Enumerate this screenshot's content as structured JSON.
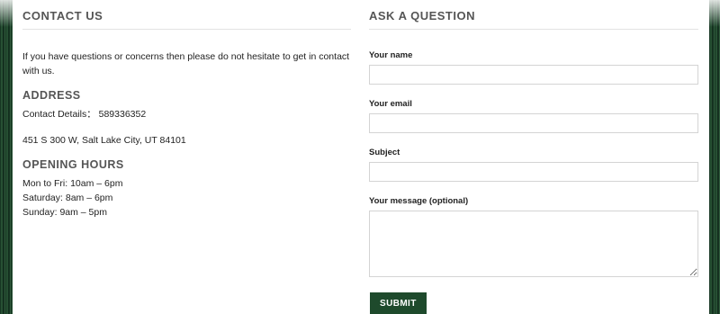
{
  "contact": {
    "title": "CONTACT US",
    "intro": "If you have questions or concerns then please do not hesitate to get in contact with us.",
    "address_heading": "ADDRESS",
    "contact_details": "Contact Details： 589336352",
    "street": "451 S 300 W, Salt Lake City, UT 84101",
    "hours_heading": "OPENING HOURS",
    "hours": [
      "Mon to Fri: 10am – 6pm",
      "Saturday: 8am – 6pm",
      "Sunday: 9am – 5pm"
    ]
  },
  "question": {
    "title": "ASK A QUESTION",
    "name_label": "Your name",
    "name_value": "",
    "email_label": "Your email",
    "email_value": "",
    "subject_label": "Subject",
    "subject_value": "",
    "message_label": "Your message (optional)",
    "message_value": "",
    "submit_label": "SUBMIT"
  },
  "colors": {
    "heading": "#555555",
    "submit_bg": "#1e4a2c"
  }
}
